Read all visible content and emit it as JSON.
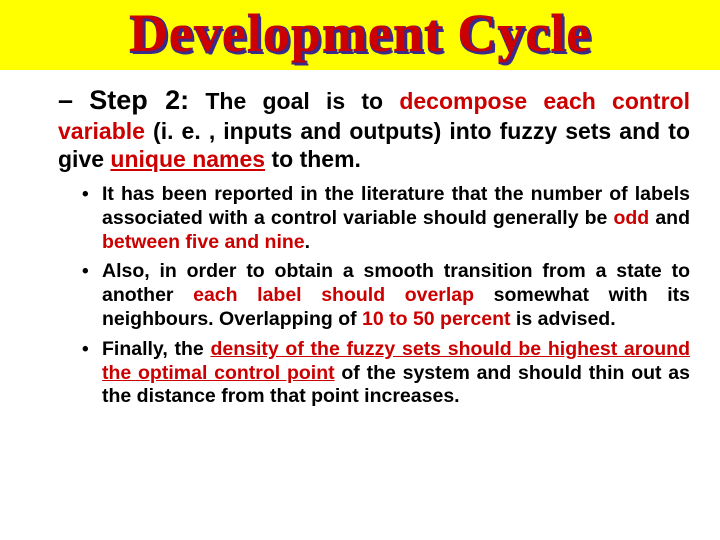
{
  "title": "Development Cycle",
  "step": {
    "dash": "–",
    "label": "Step 2:",
    "lead1": " The goal is to ",
    "key1": "decompose each control variable",
    "mid1": " (i. e. , inputs and outputs) into fuzzy sets and to give ",
    "key2": "unique names",
    "tail1": " to them."
  },
  "bullets": [
    {
      "a": "It has been reported in the literature that the number of labels associated with a control variable should generally be ",
      "r1": "odd",
      "b": " and ",
      "r2": "between five and nine",
      "c": "."
    },
    {
      "a": "Also, in order to obtain a smooth transition from a state to another ",
      "r1": "each label should overlap",
      "b": " somewhat with its neighbours. Overlapping of ",
      "r2": "10 to 50 percent",
      "c": " is advised."
    },
    {
      "a": "Finally, the ",
      "r1": "density of the fuzzy sets should be highest around the optimal control point",
      "b": " of the system and should thin out as the distance from that point increases.",
      "r2": "",
      "c": ""
    }
  ]
}
